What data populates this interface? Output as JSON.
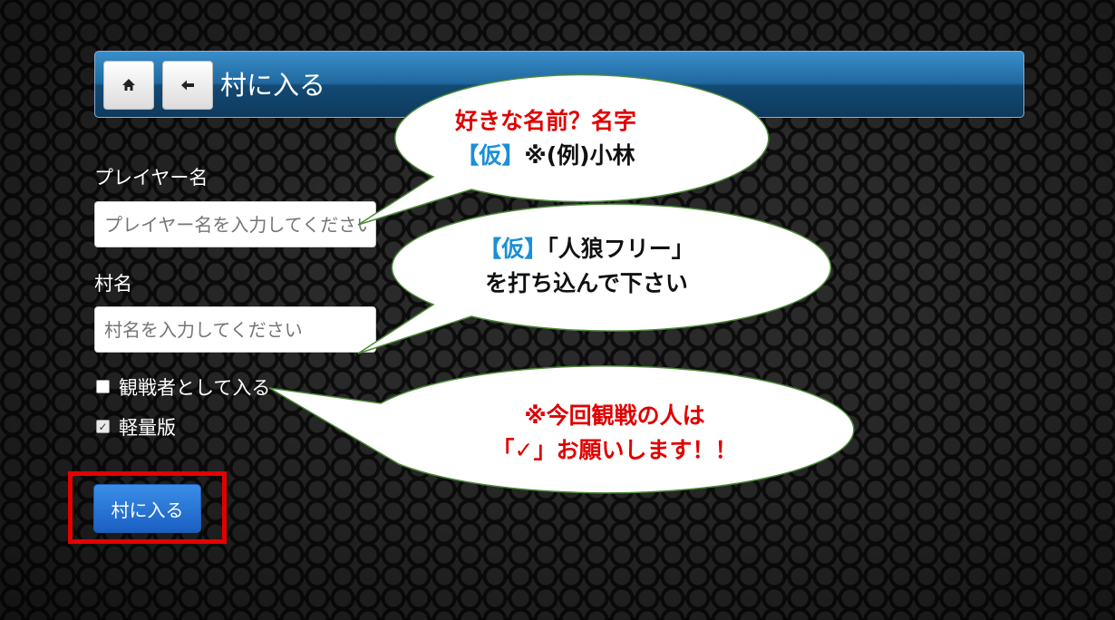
{
  "header": {
    "title": "村に入る",
    "home_icon": "home-icon",
    "back_icon": "arrow-left-icon",
    "home_label": "home",
    "back_label": "back"
  },
  "form": {
    "player_label": "プレイヤー名",
    "player_placeholder": "プレイヤー名を入力してください",
    "village_label": "村名",
    "village_placeholder": "村名を入力してください",
    "spectator_label": "観戦者として入る",
    "spectator_checked": false,
    "light_label": "軽量版",
    "light_checked": true,
    "submit_label": "村に入る"
  },
  "annotations": {
    "bubble1_line1": "好きな名前？名字",
    "bubble1_tag": "【仮】",
    "bubble1_rest": "※(例)小林",
    "bubble2_tag": "【仮】",
    "bubble2_rest": "「人狼フリー」",
    "bubble2_line2": "を打ち込んで下さい",
    "bubble3_line1": "※今回観戦の人は",
    "bubble3_line2": "「✓」お願いします！！",
    "highlight_color": "#e30000",
    "accent_blue": "#1b8fd6",
    "accent_red": "#e00000"
  }
}
